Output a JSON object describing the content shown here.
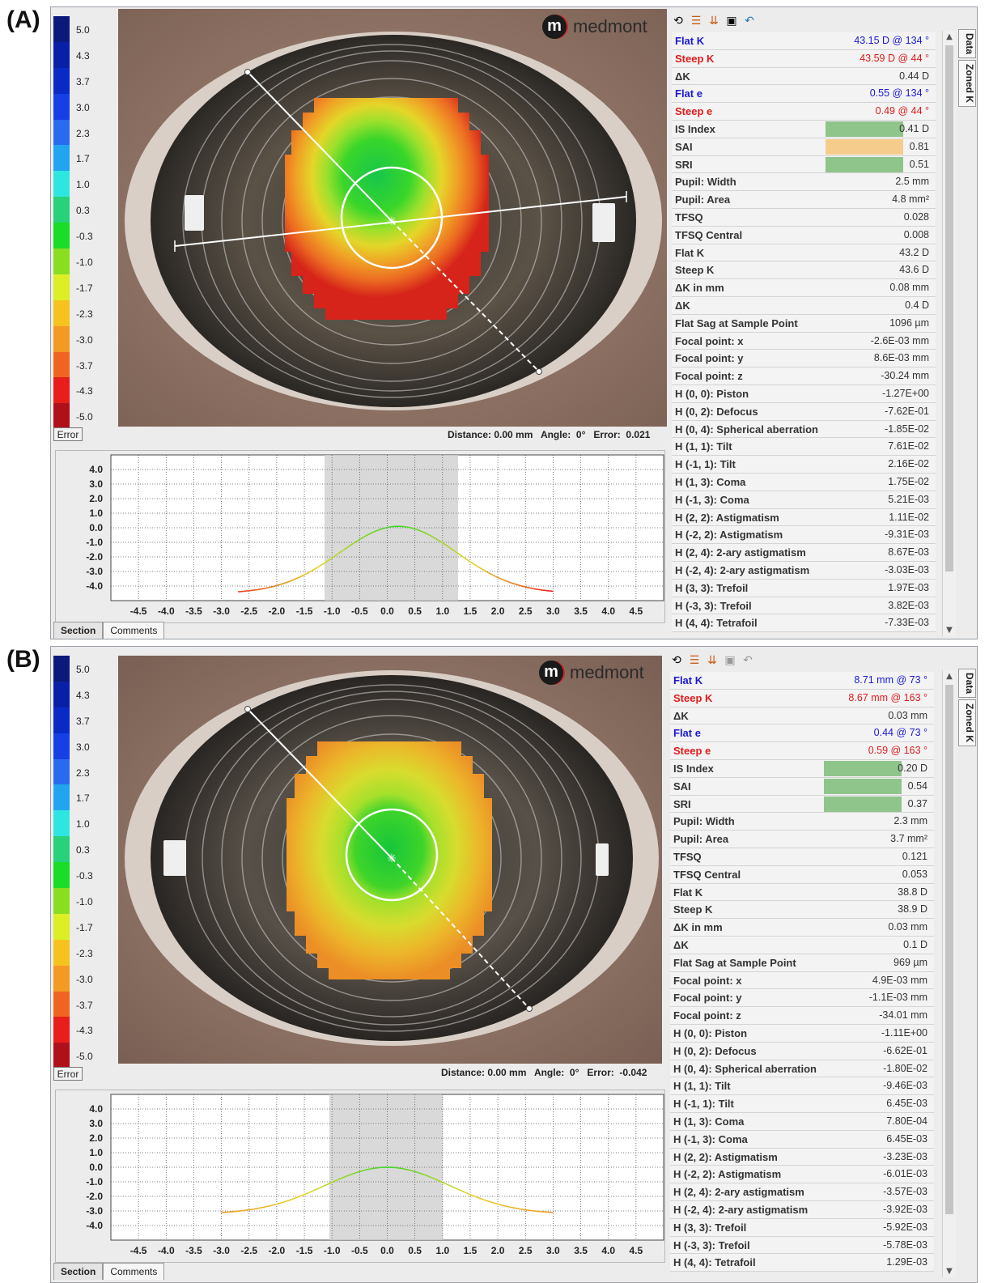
{
  "panel_a": {
    "label": "(A)",
    "logo_text": "medmont",
    "logo_mark": "m",
    "scale": [
      "5.0",
      "4.3",
      "3.7",
      "3.0",
      "2.3",
      "1.7",
      "1.0",
      "0.3",
      "-0.3",
      "-1.0",
      "-1.7",
      "-2.3",
      "-3.0",
      "-3.7",
      "-4.3",
      "-5.0"
    ],
    "error_label": "Error",
    "status": "Distance: 0.00 mm   Angle:  0°   Error:  0.021",
    "plot_y_ticks": [
      "4.0",
      "3.0",
      "2.0",
      "1.0",
      "0.0",
      "-1.0",
      "-2.0",
      "-3.0",
      "-4.0"
    ],
    "plot_x_ticks": [
      "-4.5",
      "-4.0",
      "-3.5",
      "-3.0",
      "-2.5",
      "-2.0",
      "-1.5",
      "-1.0",
      "-0.5",
      "0.0",
      "0.5",
      "1.0",
      "1.5",
      "2.0",
      "2.5",
      "3.0",
      "3.5",
      "4.0",
      "4.5"
    ],
    "tabs": [
      "Section",
      "Comments"
    ],
    "vtabs": [
      "Data",
      "Zoned K"
    ],
    "rows": [
      {
        "label": "Flat K",
        "value": "43.15 D @ 134 °",
        "color": "#1a1ad6"
      },
      {
        "label": "Steep K",
        "value": "43.59 D @  44 °",
        "color": "#e01b1b"
      },
      {
        "label": "ΔK",
        "value": "0.44 D"
      },
      {
        "label": "Flat e",
        "value": "0.55 @ 134 °",
        "color": "#1a1ad6"
      },
      {
        "label": "Steep e",
        "value": "0.49 @  44 °",
        "color": "#e01b1b"
      },
      {
        "label": "IS Index",
        "value": "0.41 D",
        "hl": "#8fc48b"
      },
      {
        "label": "SAI",
        "value": "0.81",
        "hl": "#f5cc8c"
      },
      {
        "label": "SRI",
        "value": "0.51",
        "hl": "#8fc48b"
      },
      {
        "label": "Pupil: Width",
        "value": "2.5 mm"
      },
      {
        "label": "Pupil: Area",
        "value": "4.8 mm²"
      },
      {
        "label": "TFSQ",
        "value": "0.028"
      },
      {
        "label": "TFSQ Central",
        "value": "0.008"
      },
      {
        "label": "Flat K",
        "value": "43.2 D"
      },
      {
        "label": "Steep K",
        "value": "43.6 D"
      },
      {
        "label": "ΔK in mm",
        "value": "0.08 mm"
      },
      {
        "label": "ΔK",
        "value": "0.4 D"
      },
      {
        "label": "Flat Sag at Sample Point",
        "value": "1096 µm"
      },
      {
        "label": "Focal point: x",
        "value": "-2.6E-03 mm"
      },
      {
        "label": "Focal point: y",
        "value": "8.6E-03 mm"
      },
      {
        "label": "Focal point: z",
        "value": "-30.24 mm"
      },
      {
        "label": "H (0, 0): Piston",
        "value": "-1.27E+00"
      },
      {
        "label": "H (0, 2): Defocus",
        "value": "-7.62E-01"
      },
      {
        "label": "H (0, 4): Spherical aberration",
        "value": "-1.85E-02"
      },
      {
        "label": "H (1, 1): Tilt",
        "value": "7.61E-02"
      },
      {
        "label": "H (-1, 1): Tilt",
        "value": "2.16E-02"
      },
      {
        "label": "H (1, 3): Coma",
        "value": "1.75E-02"
      },
      {
        "label": "H (-1, 3): Coma",
        "value": "5.21E-03"
      },
      {
        "label": "H (2, 2): Astigmatism",
        "value": "1.11E-02"
      },
      {
        "label": "H (-2, 2): Astigmatism",
        "value": "-9.31E-03"
      },
      {
        "label": "H (2, 4): 2-ary astigmatism",
        "value": "8.67E-03"
      },
      {
        "label": "H (-2, 4): 2-ary astigmatism",
        "value": "-3.03E-03"
      },
      {
        "label": "H (3, 3): Trefoil",
        "value": "1.97E-03"
      },
      {
        "label": "H (-3, 3): Trefoil",
        "value": "3.82E-03"
      },
      {
        "label": "H (4, 4): Tetrafoil",
        "value": "-7.33E-03"
      }
    ]
  },
  "panel_b": {
    "label": "(B)",
    "logo_text": "medmont",
    "logo_mark": "m",
    "scale": [
      "5.0",
      "4.3",
      "3.7",
      "3.0",
      "2.3",
      "1.7",
      "1.0",
      "0.3",
      "-0.3",
      "-1.0",
      "-1.7",
      "-2.3",
      "-3.0",
      "-3.7",
      "-4.3",
      "-5.0"
    ],
    "error_label": "Error",
    "status": "Distance: 0.00 mm   Angle:  0°   Error:  -0.042",
    "plot_y_ticks": [
      "4.0",
      "3.0",
      "2.0",
      "1.0",
      "0.0",
      "-1.0",
      "-2.0",
      "-3.0",
      "-4.0"
    ],
    "plot_x_ticks": [
      "-4.5",
      "-4.0",
      "-3.5",
      "-3.0",
      "-2.5",
      "-2.0",
      "-1.5",
      "-1.0",
      "-0.5",
      "0.0",
      "0.5",
      "1.0",
      "1.5",
      "2.0",
      "2.5",
      "3.0",
      "3.5",
      "4.0",
      "4.5"
    ],
    "tabs": [
      "Section",
      "Comments"
    ],
    "vtabs": [
      "Data",
      "Zoned K"
    ],
    "rows": [
      {
        "label": "Flat K",
        "value": "8.71 mm @  73 °",
        "color": "#1a1ad6"
      },
      {
        "label": "Steep K",
        "value": "8.67 mm @ 163 °",
        "color": "#e01b1b"
      },
      {
        "label": "ΔK",
        "value": "0.03 mm"
      },
      {
        "label": "Flat e",
        "value": "0.44 @  73 °",
        "color": "#1a1ad6"
      },
      {
        "label": "Steep e",
        "value": "0.59 @ 163 °",
        "color": "#e01b1b"
      },
      {
        "label": "IS Index",
        "value": "0.20 D",
        "hl": "#8fc48b"
      },
      {
        "label": "SAI",
        "value": "0.54",
        "hl": "#8fc48b"
      },
      {
        "label": "SRI",
        "value": "0.37",
        "hl": "#8fc48b"
      },
      {
        "label": "Pupil: Width",
        "value": "2.3 mm"
      },
      {
        "label": "Pupil: Area",
        "value": "3.7 mm²"
      },
      {
        "label": "TFSQ",
        "value": "0.121"
      },
      {
        "label": "TFSQ Central",
        "value": "0.053"
      },
      {
        "label": "Flat K",
        "value": "38.8 D"
      },
      {
        "label": "Steep K",
        "value": "38.9 D"
      },
      {
        "label": "ΔK in mm",
        "value": "0.03 mm"
      },
      {
        "label": "ΔK",
        "value": "0.1 D"
      },
      {
        "label": "Flat Sag at Sample Point",
        "value": "969 µm"
      },
      {
        "label": "Focal point: x",
        "value": "4.9E-03 mm"
      },
      {
        "label": "Focal point: y",
        "value": "-1.1E-03 mm"
      },
      {
        "label": "Focal point: z",
        "value": "-34.01 mm"
      },
      {
        "label": "H (0, 0): Piston",
        "value": "-1.11E+00"
      },
      {
        "label": "H (0, 2): Defocus",
        "value": "-6.62E-01"
      },
      {
        "label": "H (0, 4): Spherical aberration",
        "value": "-1.80E-02"
      },
      {
        "label": "H (1, 1): Tilt",
        "value": "-9.46E-03"
      },
      {
        "label": "H (-1, 1): Tilt",
        "value": "6.45E-03"
      },
      {
        "label": "H (1, 3): Coma",
        "value": "7.80E-04"
      },
      {
        "label": "H (-1, 3): Coma",
        "value": "6.45E-03"
      },
      {
        "label": "H (2, 2): Astigmatism",
        "value": "-3.23E-03"
      },
      {
        "label": "H (-2, 2): Astigmatism",
        "value": "-6.01E-03"
      },
      {
        "label": "H (2, 4): 2-ary astigmatism",
        "value": "-3.57E-03"
      },
      {
        "label": "H (-2, 4): 2-ary astigmatism",
        "value": "-3.92E-03"
      },
      {
        "label": "H (3, 3): Trefoil",
        "value": "-5.92E-03"
      },
      {
        "label": "H (-3, 3): Trefoil",
        "value": "-5.78E-03"
      },
      {
        "label": "H (4, 4): Tetrafoil",
        "value": "1.29E-03"
      }
    ]
  },
  "scale_colors": [
    "#0b1a7a",
    "#0a1fa8",
    "#0a2ac8",
    "#1640e6",
    "#2a6af0",
    "#22a4f0",
    "#2ee6e0",
    "#27d27a",
    "#19dd27",
    "#8ade20",
    "#dcee24",
    "#f6c21e",
    "#f29a22",
    "#f06422",
    "#e81d1c",
    "#b0101a"
  ]
}
